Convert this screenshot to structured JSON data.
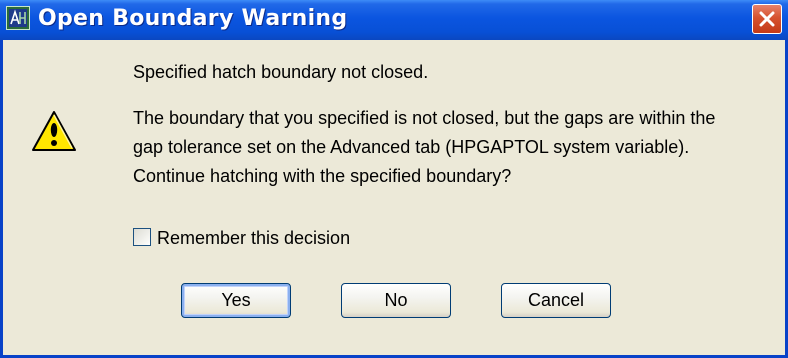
{
  "window": {
    "title": "Open Boundary Warning",
    "title_icon": "autocad-app-icon",
    "close_icon": "close-icon"
  },
  "message": {
    "icon": "warning-icon",
    "heading": "Specified hatch boundary not closed.",
    "body": "The boundary that you specified is not closed, but the gaps are within the gap tolerance set on the Advanced tab (HPGAPTOL system variable). Continue hatching with the specified boundary?"
  },
  "checkbox": {
    "label": "Remember this decision",
    "checked": false
  },
  "buttons": {
    "yes": "Yes",
    "no": "No",
    "cancel": "Cancel"
  },
  "colors": {
    "titlebar": "#0850d6",
    "dialog_background": "#ece9d8",
    "close_button": "#d6522f",
    "warning_triangle": "#ffe600"
  }
}
